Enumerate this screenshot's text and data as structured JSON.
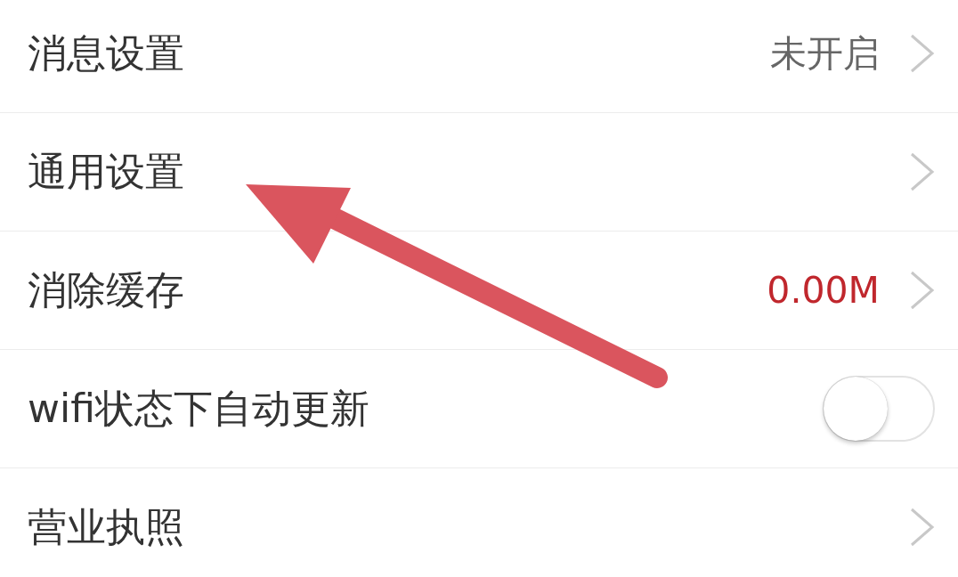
{
  "rows": [
    {
      "kind": "link",
      "label": "消息设置",
      "value": {
        "text": "未开启",
        "color": "#666666"
      }
    },
    {
      "kind": "link",
      "label": "通用设置"
    },
    {
      "kind": "link",
      "label": "消除缓存",
      "value": {
        "text": "0.00M",
        "color": "#c0272d"
      }
    },
    {
      "kind": "toggle",
      "label": "wifi状态下自动更新",
      "on": false
    },
    {
      "kind": "link",
      "label": "营业执照"
    }
  ],
  "annotation": {
    "kind": "arrow"
  }
}
